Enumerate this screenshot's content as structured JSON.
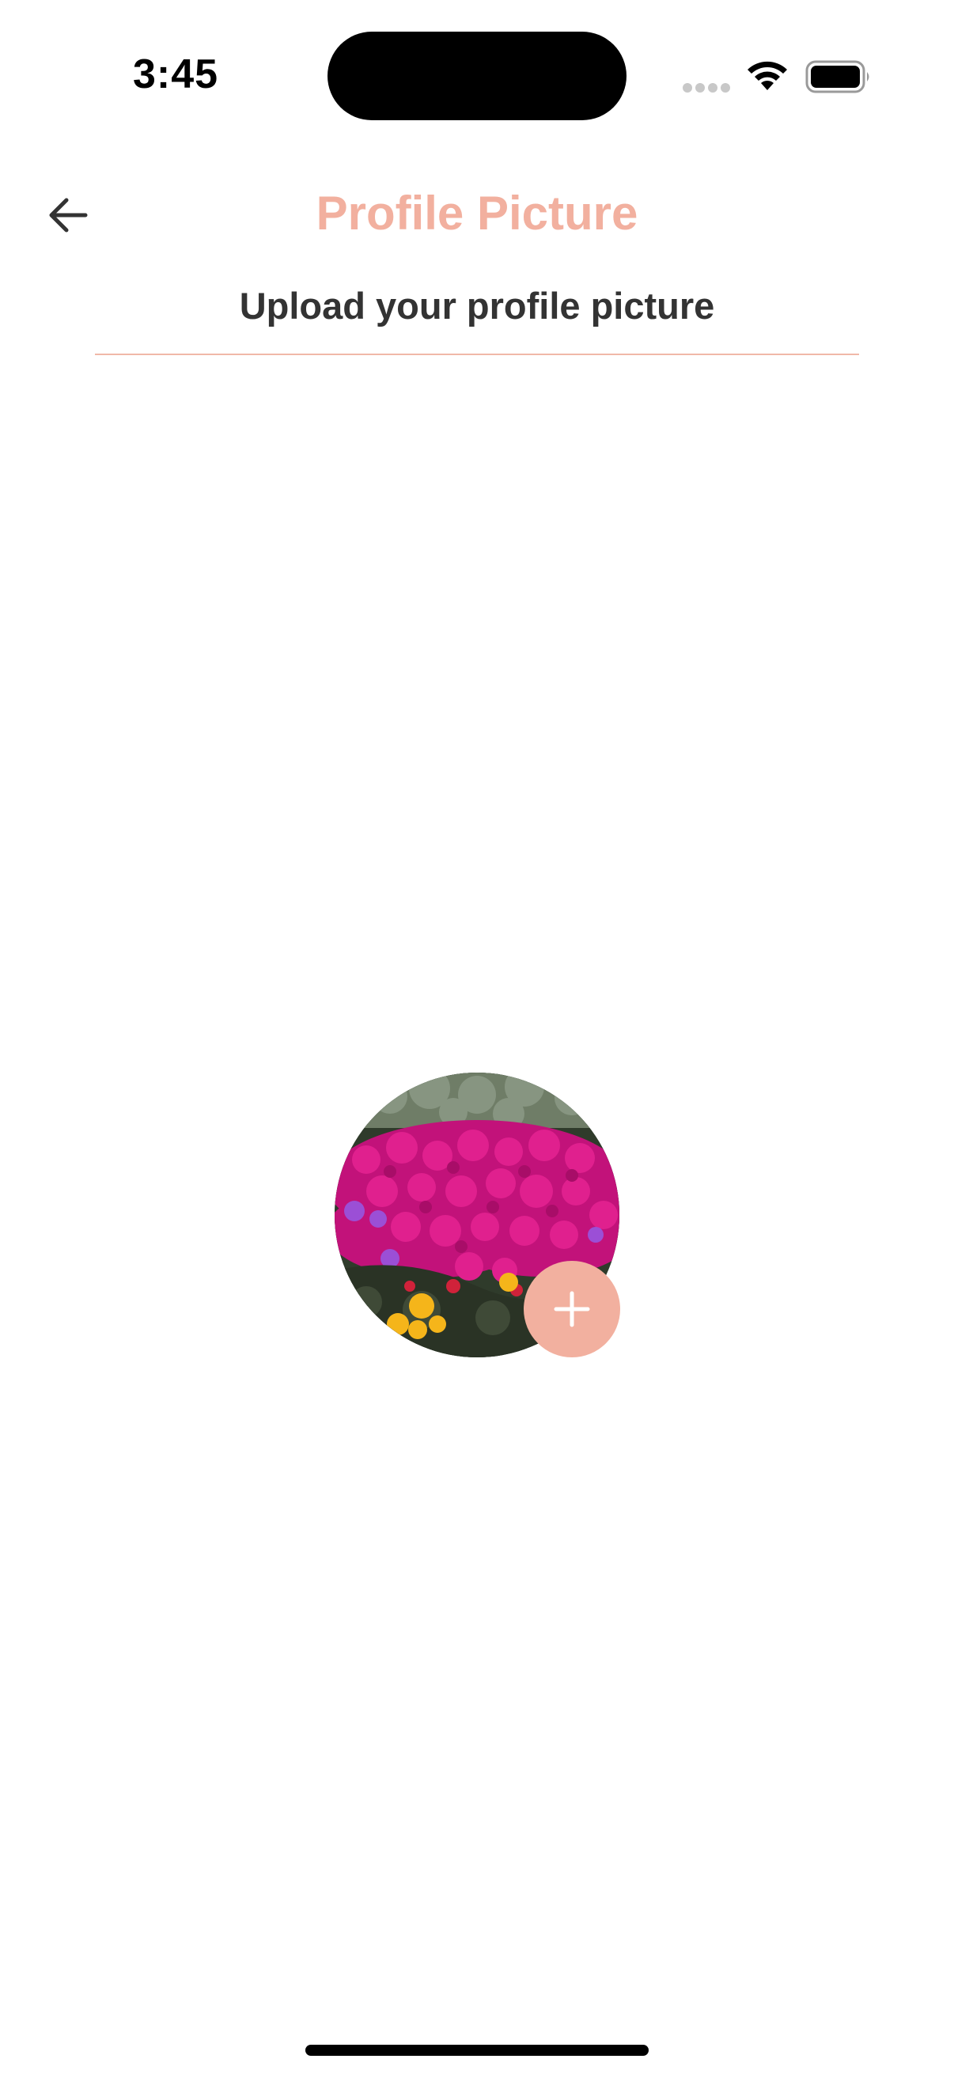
{
  "status_bar": {
    "time": "3:45",
    "icons": [
      "cellular-signal-icon",
      "wifi-icon",
      "battery-icon"
    ]
  },
  "header": {
    "back_icon": "arrow-left-icon",
    "title": "Profile Picture"
  },
  "main": {
    "subtitle": "Upload your profile picture",
    "avatar": {
      "image_description_icon": "flower-field-photo",
      "add_icon": "plus-icon"
    }
  },
  "colors": {
    "accent": "#f2b09f",
    "text_dark": "#333333",
    "divider": "#f0b8a8"
  }
}
